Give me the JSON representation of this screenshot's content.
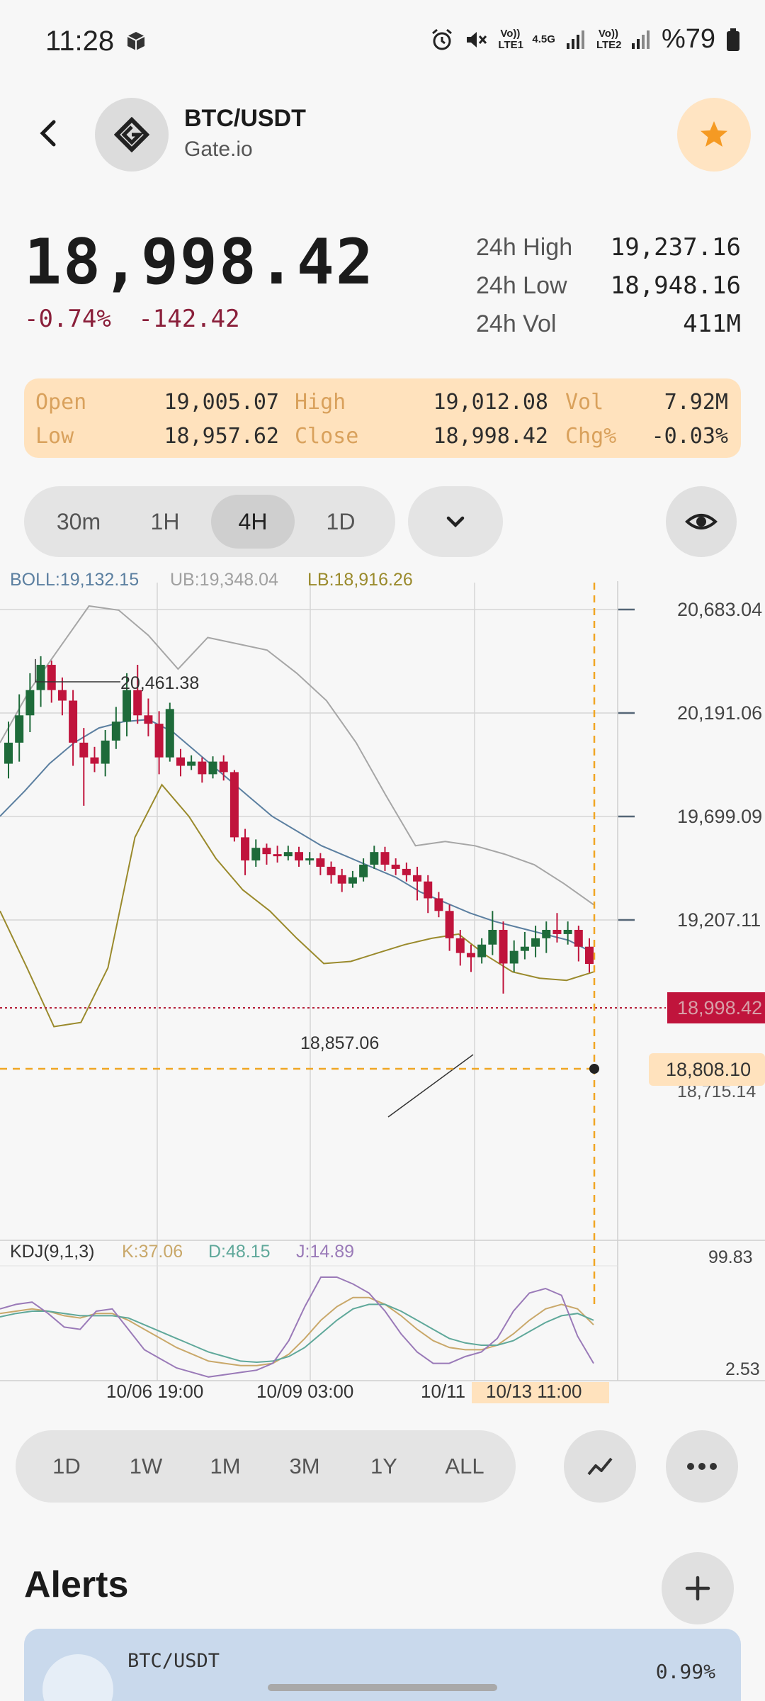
{
  "status_bar": {
    "time": "11:28",
    "network1": "Vo)) LTE1",
    "network_speed": "4.5G",
    "network2": "Vo)) LTE2",
    "battery": "%79"
  },
  "header": {
    "pair": "BTC/USDT",
    "exchange": "Gate.io"
  },
  "price": {
    "last": "18,998.42",
    "change_pct": "-0.74%",
    "change_abs": "-142.42"
  },
  "stats": [
    {
      "label": "24h High",
      "value": "19,237.16"
    },
    {
      "label": "24h Low",
      "value": "18,948.16"
    },
    {
      "label": "24h Vol",
      "value": "411M"
    }
  ],
  "ohlc": {
    "open_label": "Open",
    "open": "19,005.07",
    "high_label": "High",
    "high": "19,012.08",
    "vol_label": "Vol",
    "vol": "7.92M",
    "low_label": "Low",
    "low": "18,957.62",
    "close_label": "Close",
    "close": "18,998.42",
    "chg_label": "Chg%",
    "chg": "-0.03%"
  },
  "intervals": [
    "30m",
    "1H",
    "4H",
    "1D"
  ],
  "active_interval": "4H",
  "indicators": {
    "boll": "BOLL:19,132.15",
    "ub": "UB:19,348.04",
    "lb": "LB:18,916.26",
    "kdj": "KDJ(9,1,3)",
    "k": "K:37.06",
    "d": "D:48.15",
    "j": "J:14.89"
  },
  "chart_data": {
    "type": "candlestick",
    "y_ticks": [
      "20,683.04",
      "20,191.06",
      "19,699.09",
      "19,207.11"
    ],
    "current_price_label": "18,998.42",
    "crosshair_price_label": "18,808.10",
    "partial_tick": "18,715.14",
    "max_annotation": "20,461.38",
    "min_annotation": "18,857.06",
    "kdj_high": "99.83",
    "kdj_low": "2.53",
    "x_labels": [
      "10/06 19:00",
      "10/09 03:00",
      "10/11"
    ],
    "crosshair_time": "10/13 11:00",
    "colors": {
      "up": "#1e6b3a",
      "down": "#c0143c",
      "boll": "#5b7fa0",
      "ub": "#a6a6a6",
      "lb": "#9a8a2c"
    },
    "candles": [
      {
        "o": 19950,
        "c": 20050,
        "h": 20150,
        "l": 19880
      },
      {
        "o": 20050,
        "c": 20180,
        "h": 20280,
        "l": 19960
      },
      {
        "o": 20180,
        "c": 20300,
        "h": 20380,
        "l": 20100
      },
      {
        "o": 20300,
        "c": 20420,
        "h": 20461,
        "l": 20220
      },
      {
        "o": 20420,
        "c": 20300,
        "h": 20440,
        "l": 20240
      },
      {
        "o": 20300,
        "c": 20250,
        "h": 20360,
        "l": 20180
      },
      {
        "o": 20250,
        "c": 20050,
        "h": 20300,
        "l": 19940
      },
      {
        "o": 20050,
        "c": 19980,
        "h": 20120,
        "l": 19750
      },
      {
        "o": 19980,
        "c": 19950,
        "h": 20030,
        "l": 19910
      },
      {
        "o": 19950,
        "c": 20060,
        "h": 20110,
        "l": 19890
      },
      {
        "o": 20060,
        "c": 20150,
        "h": 20220,
        "l": 20020
      },
      {
        "o": 20150,
        "c": 20300,
        "h": 20380,
        "l": 20080
      },
      {
        "o": 20300,
        "c": 20180,
        "h": 20420,
        "l": 20140
      },
      {
        "o": 20180,
        "c": 20140,
        "h": 20260,
        "l": 20080
      },
      {
        "o": 20140,
        "c": 19980,
        "h": 20200,
        "l": 19900
      },
      {
        "o": 19980,
        "c": 20210,
        "h": 20240,
        "l": 19960
      },
      {
        "o": 19980,
        "c": 19940,
        "h": 20020,
        "l": 19890
      },
      {
        "o": 19940,
        "c": 19960,
        "h": 19990,
        "l": 19920
      },
      {
        "o": 19960,
        "c": 19900,
        "h": 19980,
        "l": 19860
      },
      {
        "o": 19900,
        "c": 19960,
        "h": 19985,
        "l": 19880
      },
      {
        "o": 19960,
        "c": 19910,
        "h": 19990,
        "l": 19870
      },
      {
        "o": 19910,
        "c": 19600,
        "h": 19920,
        "l": 19580
      },
      {
        "o": 19600,
        "c": 19490,
        "h": 19640,
        "l": 19420
      },
      {
        "o": 19490,
        "c": 19550,
        "h": 19590,
        "l": 19460
      },
      {
        "o": 19550,
        "c": 19520,
        "h": 19570,
        "l": 19470
      },
      {
        "o": 19520,
        "c": 19510,
        "h": 19560,
        "l": 19480
      },
      {
        "o": 19510,
        "c": 19530,
        "h": 19560,
        "l": 19490
      },
      {
        "o": 19530,
        "c": 19490,
        "h": 19555,
        "l": 19460
      },
      {
        "o": 19490,
        "c": 19500,
        "h": 19530,
        "l": 19470
      },
      {
        "o": 19500,
        "c": 19460,
        "h": 19525,
        "l": 19420
      },
      {
        "o": 19460,
        "c": 19420,
        "h": 19485,
        "l": 19380
      },
      {
        "o": 19420,
        "c": 19380,
        "h": 19450,
        "l": 19340
      },
      {
        "o": 19380,
        "c": 19410,
        "h": 19440,
        "l": 19360
      },
      {
        "o": 19410,
        "c": 19470,
        "h": 19500,
        "l": 19390
      },
      {
        "o": 19470,
        "c": 19530,
        "h": 19560,
        "l": 19450
      },
      {
        "o": 19530,
        "c": 19470,
        "h": 19555,
        "l": 19440
      },
      {
        "o": 19470,
        "c": 19450,
        "h": 19500,
        "l": 19420
      },
      {
        "o": 19450,
        "c": 19420,
        "h": 19480,
        "l": 19390
      },
      {
        "o": 19420,
        "c": 19390,
        "h": 19460,
        "l": 19300
      },
      {
        "o": 19390,
        "c": 19310,
        "h": 19420,
        "l": 19240
      },
      {
        "o": 19310,
        "c": 19250,
        "h": 19340,
        "l": 19220
      },
      {
        "o": 19250,
        "c": 19120,
        "h": 19280,
        "l": 19060
      },
      {
        "o": 19120,
        "c": 19050,
        "h": 19160,
        "l": 18990
      },
      {
        "o": 19050,
        "c": 19030,
        "h": 19090,
        "l": 18960
      },
      {
        "o": 19030,
        "c": 19090,
        "h": 19120,
        "l": 19000
      },
      {
        "o": 19090,
        "c": 19160,
        "h": 19250,
        "l": 19040
      },
      {
        "o": 19160,
        "c": 19000,
        "h": 19200,
        "l": 18857
      },
      {
        "o": 19000,
        "c": 19060,
        "h": 19110,
        "l": 18960
      },
      {
        "o": 19060,
        "c": 19080,
        "h": 19150,
        "l": 19020
      },
      {
        "o": 19080,
        "c": 19120,
        "h": 19180,
        "l": 19030
      },
      {
        "o": 19120,
        "c": 19160,
        "h": 19200,
        "l": 19050
      },
      {
        "o": 19160,
        "c": 19140,
        "h": 19240,
        "l": 19100
      },
      {
        "o": 19140,
        "c": 19160,
        "h": 19200,
        "l": 19090
      },
      {
        "o": 19160,
        "c": 19080,
        "h": 19180,
        "l": 19010
      },
      {
        "o": 19080,
        "c": 18998,
        "h": 19120,
        "l": 18957
      }
    ],
    "boll_mid": [
      19700,
      19820,
      19950,
      20050,
      20120,
      20150,
      20160,
      20100,
      20000,
      19900,
      19800,
      19700,
      19630,
      19560,
      19510,
      19460,
      19410,
      19340,
      19290,
      19240,
      19200,
      19170,
      19140,
      19110,
      19050
    ],
    "boll_ub": [
      20050,
      20300,
      20500,
      20700,
      20680,
      20560,
      20400,
      20550,
      20520,
      20490,
      20380,
      20250,
      20050,
      19800,
      19560,
      19580,
      19560,
      19520,
      19470,
      19380,
      19280
    ],
    "boll_lb": [
      19250,
      18980,
      18700,
      18720,
      18980,
      19600,
      19850,
      19700,
      19500,
      19350,
      19250,
      19120,
      19000,
      19010,
      19050,
      19090,
      19120,
      19140,
      19040,
      18960,
      18930,
      18920,
      18960
    ]
  },
  "ranges": [
    "1D",
    "1W",
    "1M",
    "3M",
    "1Y",
    "ALL"
  ],
  "alerts": {
    "title": "Alerts",
    "card_pair": "BTC/USDT",
    "card_pct": "0.99%"
  }
}
